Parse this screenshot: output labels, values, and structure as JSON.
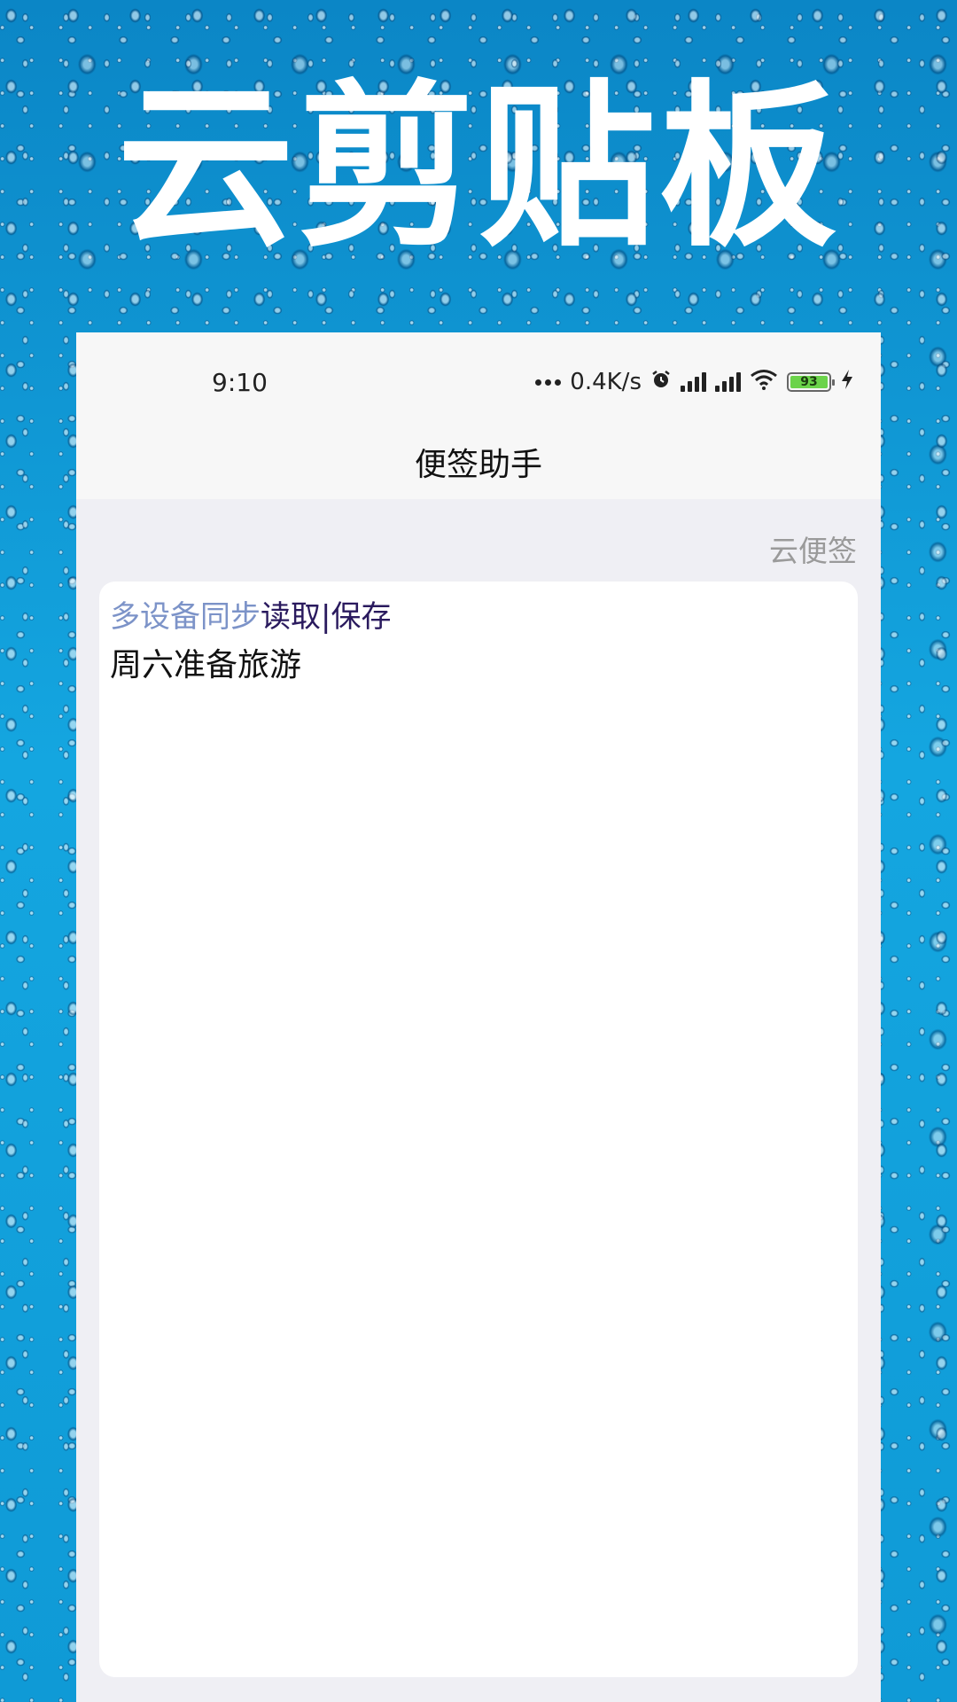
{
  "hero": {
    "title": "云剪贴板"
  },
  "status_bar": {
    "time": "9:10",
    "net_speed": "0.4K/s",
    "battery_level": "93",
    "icons": [
      "network-activity-icon",
      "alarm-icon",
      "signal-icon",
      "signal-icon",
      "wifi-icon",
      "battery-icon",
      "charging-icon"
    ]
  },
  "nav": {
    "title": "便签助手"
  },
  "cloud_link": "云便签",
  "note": {
    "sync_label": "多设备同步",
    "read_label": "读取",
    "separator": "|",
    "save_label": "保存",
    "content": "周六准备旅游"
  },
  "colors": {
    "background": "#0a8fd0",
    "sync_label": "#7c93c8",
    "action_label": "#2a1a5e",
    "battery": "#6bd34a"
  }
}
